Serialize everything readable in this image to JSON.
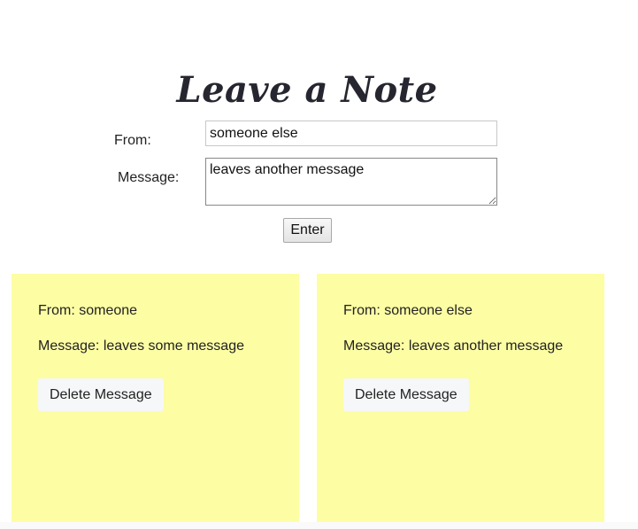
{
  "header": {
    "title": "Leave a Note"
  },
  "form": {
    "from_label": "From:",
    "from_value": "someone else",
    "message_label": "Message:",
    "message_value": "leaves another message",
    "submit_label": "Enter"
  },
  "notes": [
    {
      "from": "From: someone",
      "message": "Message: leaves some message",
      "delete_label": "Delete Message"
    },
    {
      "from": "From: someone else",
      "message": "Message: leaves another message",
      "delete_label": "Delete Message"
    }
  ],
  "colors": {
    "note_background": "#fdfda4",
    "button_background": "#f5f7f9"
  }
}
